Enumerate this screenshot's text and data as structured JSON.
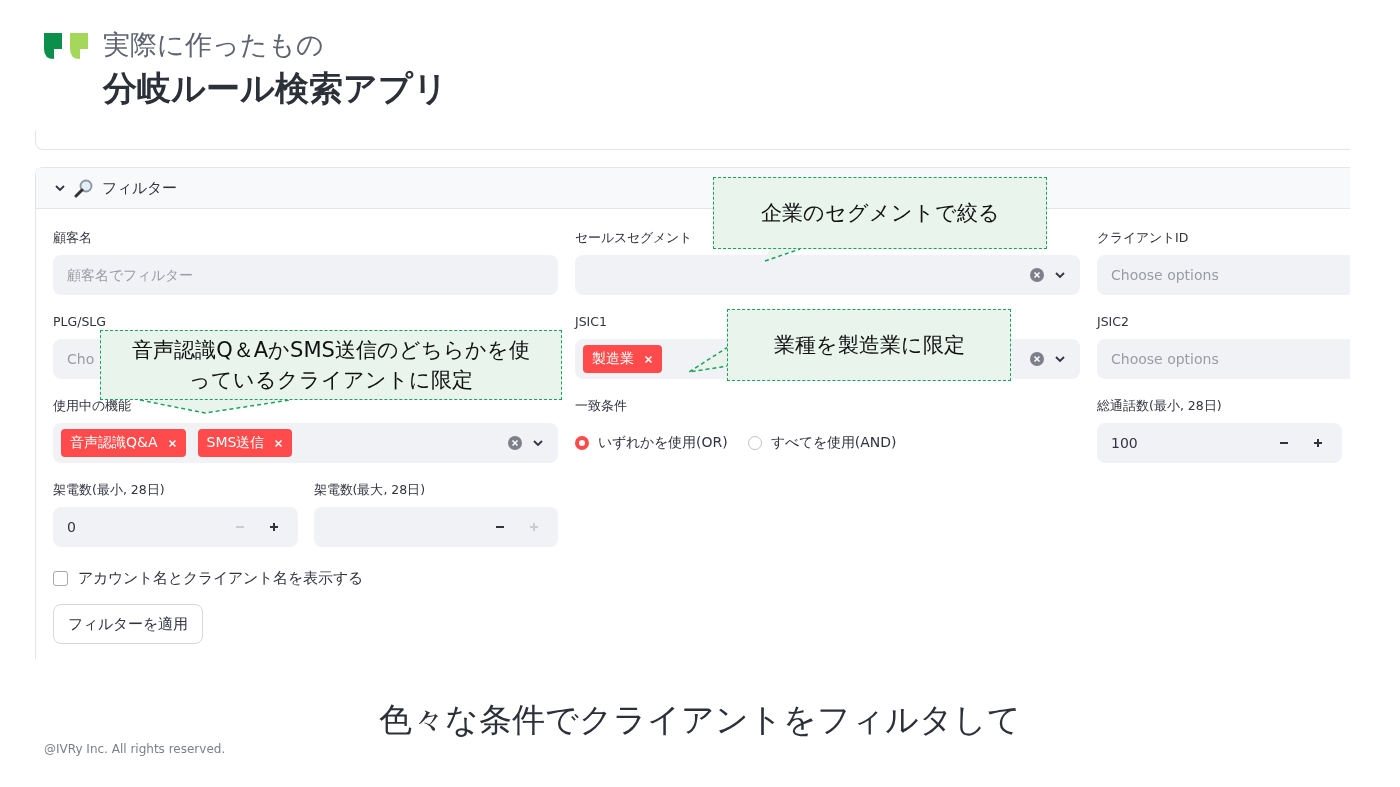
{
  "header": {
    "subtitle": "実際に作ったもの",
    "title": "分岐ルール検索アプリ"
  },
  "expander": {
    "label": "フィルター",
    "expanded": true
  },
  "rows": [
    [
      {
        "kind": "text",
        "label": "顧客名",
        "placeholder": "顧客名でフィルター"
      },
      {
        "kind": "multiselect",
        "label": "セールスセグメント",
        "clearable": true,
        "chevron": true
      },
      {
        "kind": "multiselect",
        "label": "クライアントID",
        "placeholder": "Choose options"
      }
    ],
    [
      {
        "kind": "multiselect",
        "label": "PLG/SLG",
        "placeholder": "Cho"
      },
      {
        "kind": "multiselect",
        "label": "JSIC1",
        "tags": [
          "製造業"
        ],
        "clearable": true,
        "chevron": true
      },
      {
        "kind": "multiselect",
        "label": "JSIC2",
        "placeholder": "Choose options"
      }
    ],
    [
      {
        "kind": "multiselect",
        "label": "使用中の機能",
        "tags": [
          "音声認識Q&A",
          "SMS送信"
        ],
        "clearable": true,
        "chevron": true
      },
      {
        "kind": "radio",
        "label": "一致条件",
        "options": [
          {
            "label": "いずれかを使用(OR)",
            "selected": true
          },
          {
            "label": "すべてを使用(AND)",
            "selected": false
          }
        ]
      },
      {
        "kind": "number",
        "label": "総通話数(最小, 28日)",
        "value": "100",
        "minus_disabled": false,
        "plus_disabled": false
      }
    ],
    [
      {
        "kind": "numberpair",
        "items": [
          {
            "label": "架電数(最小, 28日)",
            "value": "0",
            "minus_disabled": true,
            "plus_disabled": false
          },
          {
            "label": "架電数(最大, 28日)",
            "minus_disabled": false,
            "plus_disabled": true
          }
        ]
      }
    ]
  ],
  "checkbox": {
    "label": "アカウント名とクライアント名を表示する",
    "checked": false
  },
  "apply_button": "フィルターを適用",
  "callouts": [
    "企業のセグメントで絞る",
    "音声認識Q＆AかSMS送信のどちらかを使っているクライアントに限定",
    "業種を製造業に限定"
  ],
  "caption": "色々な条件でクライアントをフィルタして",
  "footer": "@IVRy Inc. All rights reserved."
}
